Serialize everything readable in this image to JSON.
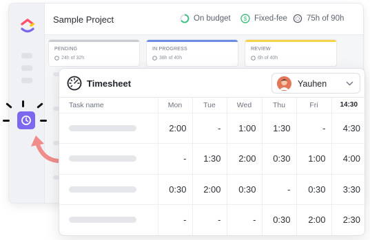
{
  "project": {
    "title": "Sample Project",
    "budget_label": "On budget",
    "fee_label": "Fixed-fee",
    "hours_label": "75h of 90h"
  },
  "statuses": [
    {
      "name": "PENDING",
      "estimate": "24h of 32h",
      "color": "#c8ccd2"
    },
    {
      "name": "IN PROGRESS",
      "estimate": "38h of 40h",
      "color": "#6c8ce8"
    },
    {
      "name": "REVIEW",
      "estimate": "6h of 40h",
      "color": "#f5d547"
    }
  ],
  "timesheet": {
    "title": "Timesheet",
    "user": "Yauhen",
    "columns": [
      "Task name",
      "Mon",
      "Tue",
      "Wed",
      "Thu",
      "Fri",
      "14:30"
    ],
    "rows": [
      [
        "2:00",
        "-",
        "1:00",
        "1:30",
        "-",
        "4:30"
      ],
      [
        "-",
        "1:30",
        "2:00",
        "0:30",
        "1:00",
        "4:00"
      ],
      [
        "0:30",
        "2:00",
        "0:30",
        "-",
        "0:30",
        "3:30"
      ],
      [
        "-",
        "-",
        "-",
        "0:30",
        "2:00",
        "2:30"
      ]
    ]
  },
  "icons": {
    "logo": "clickup-logo",
    "budget": "progress-ring-icon",
    "fee": "dollar-icon",
    "hours": "stopwatch-icon",
    "timer_button": "clock-icon",
    "timesheet": "timer-dial-icon",
    "dropdown": "chevron-down-icon"
  },
  "colors": {
    "accent": "#7b68ee",
    "arrow": "#f08c8c",
    "budget_green": "#3fbf7f"
  }
}
